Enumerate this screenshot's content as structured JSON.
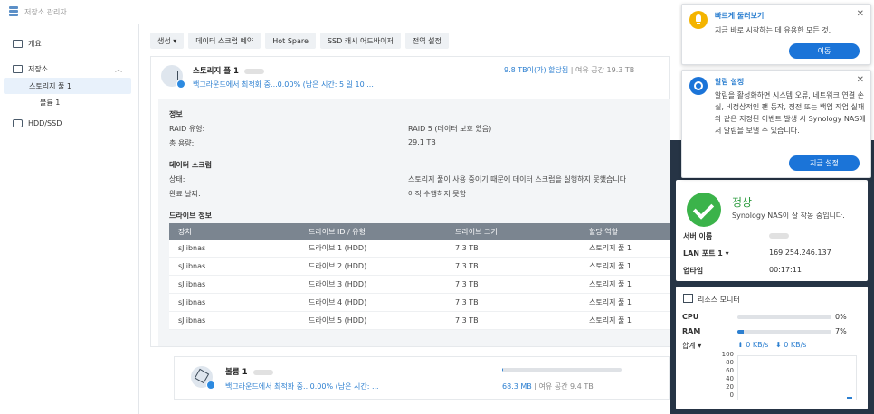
{
  "window": {
    "title": "저장소 관리자"
  },
  "sidebar": {
    "items": [
      {
        "label": "개요"
      },
      {
        "label": "저장소"
      },
      {
        "label": "스토리지 풀 1"
      },
      {
        "label": "볼륨 1"
      },
      {
        "label": "HDD/SSD"
      }
    ]
  },
  "toolbar": {
    "buttons": [
      "생성 ▾",
      "데이터 스크럽 예약",
      "Hot Spare",
      "SSD 캐시 어드바이저",
      "전역 설정"
    ]
  },
  "pool": {
    "title": "스토리지 풀 1",
    "subtitle": "백그라운드에서 최적화 중...0.00% (남은 시간: 5 일 10 ...",
    "allocated": "9.8 TB이(가) 할당됨",
    "separator": " | ",
    "free": "여유 공간 19.3 TB"
  },
  "info": {
    "section_info": "정보",
    "raid_type_label": "RAID 유형:",
    "raid_type_value": "RAID 5 (데이터 보호 있음)",
    "total_capacity_label": "총 용량:",
    "total_capacity_value": "29.1 TB",
    "section_scrub": "데이터 스크럽",
    "status_label": "상태:",
    "status_value": "스토리지 풀이 사용 중이기 때문에 데이터 스크럽을 실행하지 못했습니다",
    "completed_label": "완료 날짜:",
    "completed_value": "아직 수행하지 못함",
    "section_drives": "드라이브 정보"
  },
  "drive_table": {
    "headers": [
      "장치",
      "드라이브 ID / 유형",
      "드라이브 크기",
      "할당 역할"
    ],
    "rows": [
      [
        "sJlibnas",
        "드라이브 1 (HDD)",
        "7.3 TB",
        "스토리지 풀 1"
      ],
      [
        "sJlibnas",
        "드라이브 2 (HDD)",
        "7.3 TB",
        "스토리지 풀 1"
      ],
      [
        "sJlibnas",
        "드라이브 3 (HDD)",
        "7.3 TB",
        "스토리지 풀 1"
      ],
      [
        "sJlibnas",
        "드라이브 4 (HDD)",
        "7.3 TB",
        "스토리지 풀 1"
      ],
      [
        "sJlibnas",
        "드라이브 5 (HDD)",
        "7.3 TB",
        "스토리지 풀 1"
      ]
    ]
  },
  "volume": {
    "title": "볼륨 1",
    "subtitle": "백그라운드에서 최적화 중...0.00% (남은 시간: ...",
    "used": "68.3 MB",
    "separator": " | ",
    "free": "여유 공간 9.4 TB",
    "usage_fraction": 0.01
  },
  "health": {
    "status": "정상",
    "message": "Synology NAS이 잘 작동 중입니다.",
    "server_name_label": "서버 이름",
    "lan_label": "LAN 포트 1 ▾",
    "lan_value": "169.254.246.137",
    "uptime_label": "업타임",
    "uptime_value": "00:17:11",
    "status_color": "#3bb34a"
  },
  "resource_monitor": {
    "title": "리소스 모니터",
    "cpu_label": "CPU",
    "cpu_value": "0%",
    "cpu_fraction": 0.0,
    "ram_label": "RAM",
    "ram_value": "7%",
    "ram_fraction": 0.07,
    "total_label": "합계 ▾",
    "upload": "⬆ 0 KB/s",
    "download": "⬇ 0 KB/s",
    "y_ticks": [
      "100",
      "80",
      "60",
      "40",
      "20",
      "0"
    ]
  },
  "notifications": [
    {
      "title": "빠르게 둘러보기",
      "body": "지금 바로 시작하는 데 유용한 모든 것.",
      "button": "이동",
      "icon": "lightbulb-icon",
      "icon_color": "#f4b400"
    },
    {
      "title": "알림 설정",
      "body": "알림을 활성화하면 시스템 오류, 네트워크 연결 손실, 비정상적인 팬 동작, 정전 또는 백업 작업 실패와 같은 지정된 이벤트 발생 시 Synology NAS에서 알림을 보낼 수 있습니다.",
      "button": "지금 설정",
      "icon": "gear-icon",
      "icon_color": "#1b74d8"
    }
  ]
}
